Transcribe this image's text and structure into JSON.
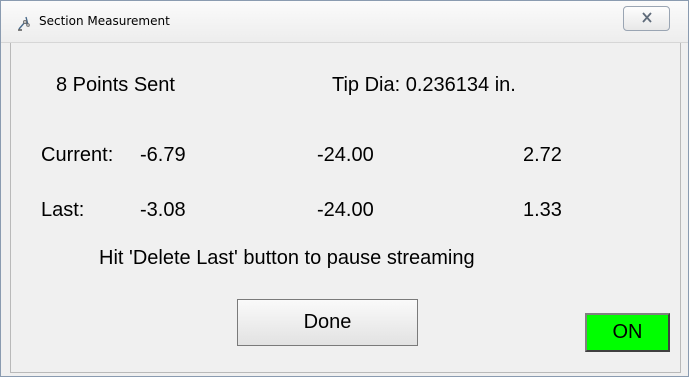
{
  "window": {
    "title": "Section Measurement",
    "close_symbol": "X",
    "icons": {
      "app": "probe-arm-icon",
      "close": "close-icon"
    }
  },
  "status": {
    "points_sent": "8 Points Sent",
    "tip_dia": "Tip Dia: 0.236134 in."
  },
  "current": {
    "label": "Current:",
    "x": "-6.79",
    "y": "-24.00",
    "z": "2.72"
  },
  "last": {
    "label": "Last:",
    "x": "-3.08",
    "y": "-24.00",
    "z": "1.33"
  },
  "hint": "Hit 'Delete Last' button to pause streaming",
  "buttons": {
    "done": "Done"
  },
  "indicator": {
    "label": "ON",
    "color": "#00ff00"
  }
}
